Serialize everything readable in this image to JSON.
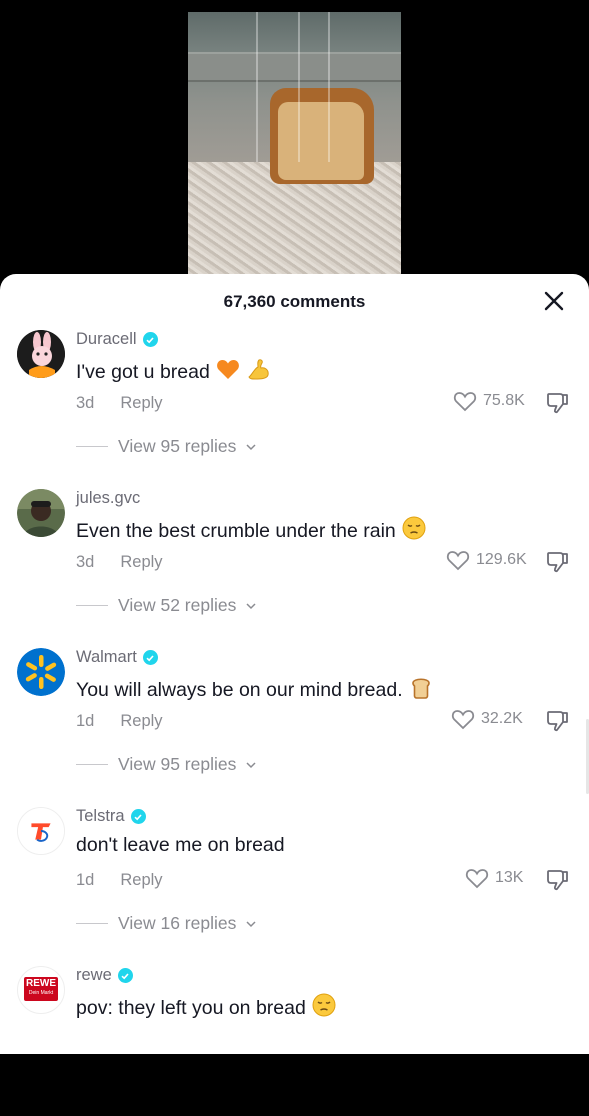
{
  "video": {
    "description_icon": "bread-in-rain-video"
  },
  "sheet": {
    "comment_count": "67,360 comments"
  },
  "comments": [
    {
      "username": "Duracell",
      "verified": true,
      "text": "I've got u bread",
      "emoji": [
        "orange-heart-icon",
        "flexed-biceps-icon"
      ],
      "age": "3d",
      "reply_label": "Reply",
      "likes": "75.8K",
      "view_replies": "View 95 replies"
    },
    {
      "username": "jules.gvc",
      "verified": false,
      "text": "Even the best crumble under the rain",
      "emoji": [
        "pensive-face-icon"
      ],
      "age": "3d",
      "reply_label": "Reply",
      "likes": "129.6K",
      "view_replies": "View 52 replies"
    },
    {
      "username": "Walmart",
      "verified": true,
      "text": "You will always be on our mind bread.",
      "emoji": [
        "bread-icon"
      ],
      "age": "1d",
      "reply_label": "Reply",
      "likes": "32.2K",
      "view_replies": "View 95 replies"
    },
    {
      "username": "Telstra",
      "verified": true,
      "text": "don't leave me on bread",
      "emoji": [],
      "age": "1d",
      "reply_label": "Reply",
      "likes": "13K",
      "view_replies": "View 16 replies"
    },
    {
      "username": "rewe",
      "verified": true,
      "text": "pov: they left you on bread",
      "emoji": [
        "pensive-face-icon"
      ],
      "age": "",
      "reply_label": "",
      "likes": "",
      "view_replies": ""
    }
  ],
  "logos": {
    "rewe_line1": "REWE",
    "rewe_line2": "Dein Markt"
  },
  "colors": {
    "verified": "#20d5ec",
    "walmart_blue": "#0071ce",
    "walmart_yellow": "#ffc220",
    "telstra_orange": "#ff4b2b",
    "rewe_red": "#cc071e"
  }
}
